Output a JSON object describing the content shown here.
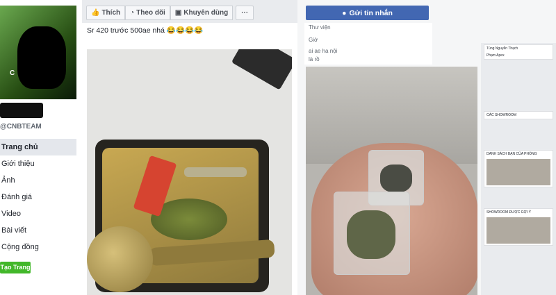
{
  "sidebar": {
    "avatar_text": "C",
    "handle": "@CNBTEAM",
    "nav": [
      {
        "label": "Trang chủ",
        "active": true
      },
      {
        "label": "Giới thiệu"
      },
      {
        "label": "Ảnh"
      },
      {
        "label": "Đánh giá"
      },
      {
        "label": "Video"
      },
      {
        "label": "Bài viết"
      },
      {
        "label": "Cộng đồng"
      }
    ],
    "create_page": "Tạo Trang"
  },
  "actions": {
    "like": "Thích",
    "follow": "Theo dõi",
    "recommend": "Khuyên dùng",
    "more": "···"
  },
  "post": {
    "text": "Sr 420 trước 500ae nhá 😂😂😂😂"
  },
  "right": {
    "send_message": "Gửi tin nhắn",
    "lines": [
      "Thư viện",
      "Giờ",
      "ai ae ha nội",
      "là rồ"
    ]
  },
  "screenshot_panel": {
    "names": [
      "Tùng Nguyễn Thạch",
      "Phạm Apex"
    ],
    "section1": "CÁC SHOWROOM",
    "section2": "DANH SÁCH BẠN CỦA PHÒNG",
    "section3": "SHOWROOM ĐƯỢC GỢI Ý"
  },
  "colors": {
    "brand": "#4267b2",
    "create": "#42b72a"
  }
}
